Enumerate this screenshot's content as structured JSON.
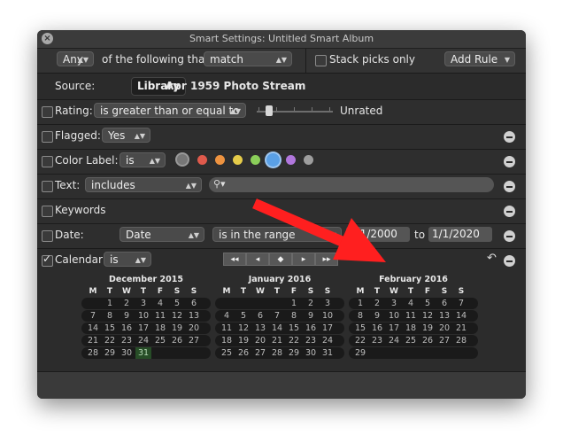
{
  "window": {
    "title": "Smart Settings: Untitled Smart Album",
    "close_glyph": "×"
  },
  "header": {
    "any_value": "Any",
    "following_label": "of the following that",
    "match_value": "match",
    "stack_picks_label": "Stack picks only",
    "add_rule_label": "Add Rule"
  },
  "source": {
    "label": "Source:",
    "library_button": "Library",
    "stream_name": "Apr 1959 Photo Stream"
  },
  "rules": {
    "rating": {
      "label": "Rating:",
      "operator": "is greater than or equal to",
      "value_label": "Unrated",
      "level": 0
    },
    "flagged": {
      "label": "Flagged:",
      "value": "Yes"
    },
    "color_label": {
      "label": "Color Label:",
      "operator": "is",
      "colors": [
        "#e05a4c",
        "#ee9340",
        "#e6cc4a",
        "#8bcf5a",
        "#5aa0e6",
        "#b177dd",
        "#9d9d9d"
      ]
    },
    "text": {
      "label": "Text:",
      "operator": "includes",
      "search_glyph": "⚲▾",
      "value": ""
    },
    "keywords": {
      "label": "Keywords"
    },
    "date": {
      "label": "Date:",
      "field": "Date",
      "operator": "is in the range",
      "from": "1/1/2000",
      "to_label": "to",
      "to": "1/1/2020"
    },
    "calendar": {
      "label": "Calendar",
      "operator": "is",
      "checked": true,
      "nav": [
        "◂◂",
        "◂",
        "◆",
        "▸",
        "▸▸"
      ],
      "undo_glyph": "↶"
    }
  },
  "calendar": {
    "weekdays": [
      "M",
      "T",
      "W",
      "T",
      "F",
      "S",
      "S"
    ],
    "months": [
      {
        "title": "December 2015",
        "start_col": 0,
        "days": [
          "",
          "1",
          "2",
          "3",
          "4",
          "5",
          "6",
          "7",
          "8",
          "9",
          "10",
          "11",
          "12",
          "13",
          "14",
          "15",
          "16",
          "17",
          "18",
          "19",
          "20",
          "21",
          "22",
          "23",
          "24",
          "25",
          "26",
          "27",
          "28",
          "29",
          "30",
          "31"
        ],
        "selected": "31"
      },
      {
        "title": "January 2016",
        "days": [
          "",
          "",
          "",
          "",
          "1",
          "2",
          "3",
          "4",
          "5",
          "6",
          "7",
          "8",
          "9",
          "10",
          "11",
          "12",
          "13",
          "14",
          "15",
          "16",
          "17",
          "18",
          "19",
          "20",
          "21",
          "22",
          "23",
          "24",
          "25",
          "26",
          "27",
          "28",
          "29",
          "30",
          "31"
        ]
      },
      {
        "title": "February 2016",
        "days": [
          "1",
          "2",
          "3",
          "4",
          "5",
          "6",
          "7",
          "8",
          "9",
          "10",
          "11",
          "12",
          "13",
          "14",
          "15",
          "16",
          "17",
          "18",
          "19",
          "20",
          "21",
          "22",
          "23",
          "24",
          "25",
          "26",
          "27",
          "28",
          "29"
        ]
      }
    ]
  },
  "colors": {
    "accent_red": "#ff1f1f",
    "window_bg": "#2d2d2d",
    "selected_day": "#274d27"
  }
}
